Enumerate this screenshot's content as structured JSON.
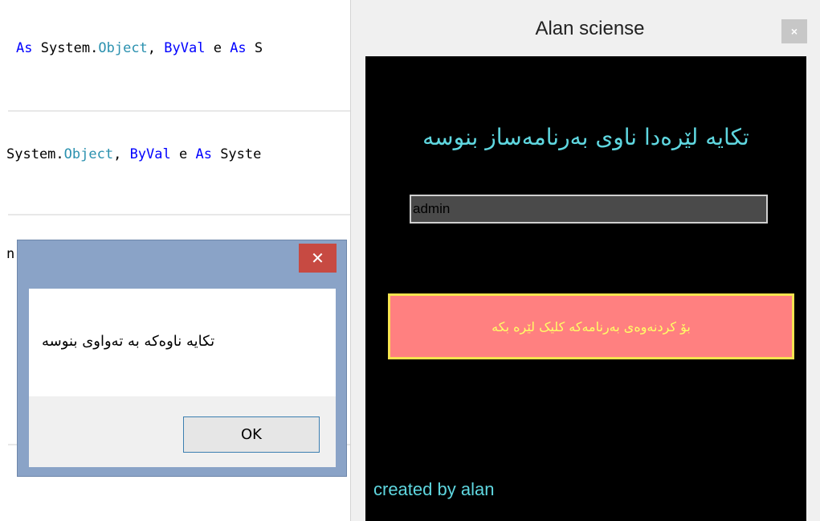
{
  "editor": {
    "line1": {
      "kw1": "As",
      "t1": " System.",
      "typ1": "Object",
      "t2": ", ",
      "kw2": "ByVal",
      "t3": " e ",
      "kw3": "As",
      "t4": " S"
    },
    "line2": {
      "t1": "System.",
      "typ1": "Object",
      "t2": ", ",
      "kw1": "ByVal",
      "t3": " e ",
      "kw2": "As",
      "t4": " Syste"
    },
    "line3": {
      "t1": "n"
    }
  },
  "message_box": {
    "close_label": "✕",
    "message": "تکایە ناوەکە بە تەواوی بنوسە",
    "ok_label": "OK",
    "colors": {
      "frame": "#8aa3c7",
      "close": "#c74a42"
    }
  },
  "form": {
    "title": "Alan sciense",
    "close_label": "×",
    "prompt": "تکایە لێرەدا ناوی بەرنامەساز بنوسە",
    "name_input_value": "admin",
    "open_button_label": "بۆ کردنەوەی بەرنامەکە کلیک لێرە بکە",
    "credit": "created by alan",
    "colors": {
      "background": "#000000",
      "accent_text": "#5fd7e0",
      "button_fill": "#ff8080",
      "button_border": "#f6e34f",
      "button_text": "#ffff66"
    }
  }
}
